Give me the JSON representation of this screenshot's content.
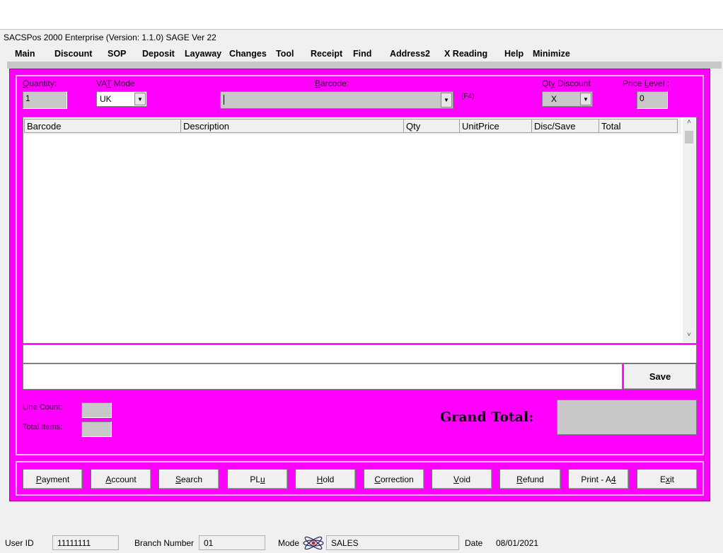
{
  "window": {
    "title": "SACSPos 2000 Enterprise  (Version: 1.1.0) SAGE Ver 22"
  },
  "menu": [
    {
      "label": "Main"
    },
    {
      "label": "Discount"
    },
    {
      "label": "SOP"
    },
    {
      "label": "Deposit"
    },
    {
      "label": "Layaway"
    },
    {
      "label": "Changes"
    },
    {
      "label": "Tool"
    },
    {
      "label": "Receipt"
    },
    {
      "label": "Find"
    },
    {
      "label": "Address2"
    },
    {
      "label": "X Reading"
    },
    {
      "label": "Help"
    },
    {
      "label": "Minimize"
    }
  ],
  "entry": {
    "quantity_label_underlined": "Q",
    "quantity_label_rest": "uantity:",
    "quantity_value": "1",
    "vat_label_pre": "VA",
    "vat_label_underlined": "T",
    "vat_label_post": " Mode",
    "vat_value": "UK",
    "barcode_label_underlined": "B",
    "barcode_label_rest": "arcode:",
    "barcode_value": "",
    "barcode_hint": "(F4)",
    "qty_discount_label_pre": "Qt",
    "qty_discount_label_underlined": "y",
    "qty_discount_label_post": " Discount",
    "qty_discount_value": "X",
    "price_level_label_pre": "Price ",
    "price_level_label_underlined": "L",
    "price_level_label_post": "evel :",
    "price_level_value": "0"
  },
  "grid": {
    "columns": [
      "Barcode",
      "Description",
      "Qty",
      "UnitPrice",
      "Disc/Save",
      "Total"
    ],
    "rows": []
  },
  "notes": {
    "save_label": "Save"
  },
  "summary": {
    "line_count_label": "Line Count:",
    "line_count_value": "",
    "total_items_label": "Total Items:",
    "total_items_value": "",
    "grand_total_label": "Grand Total:",
    "grand_total_value": ""
  },
  "actions": [
    {
      "pre": "",
      "u": "P",
      "post": "ayment"
    },
    {
      "pre": "",
      "u": "A",
      "post": "ccount"
    },
    {
      "pre": "",
      "u": "S",
      "post": "earch"
    },
    {
      "pre": "PL",
      "u": "u",
      "post": ""
    },
    {
      "pre": "",
      "u": "H",
      "post": "old"
    },
    {
      "pre": "",
      "u": "C",
      "post": "orrection"
    },
    {
      "pre": "",
      "u": "V",
      "post": "oid"
    },
    {
      "pre": "",
      "u": "R",
      "post": "efund"
    },
    {
      "pre": "Print - A",
      "u": "4",
      "post": ""
    },
    {
      "pre": "E",
      "u": "x",
      "post": "it"
    }
  ],
  "status": {
    "user_id_label": "User ID",
    "user_id_value": "11111111",
    "branch_label": "Branch Number",
    "branch_value": "01",
    "mode_label": "Mode",
    "mode_icon": "atom-icon",
    "mode_value": "SALES",
    "date_label": "Date",
    "date_value": "08/01/2021"
  },
  "colors": {
    "panel": "#ff00ff",
    "panel_border": "#ffb0ff",
    "field_gray": "#c8c8c8"
  }
}
